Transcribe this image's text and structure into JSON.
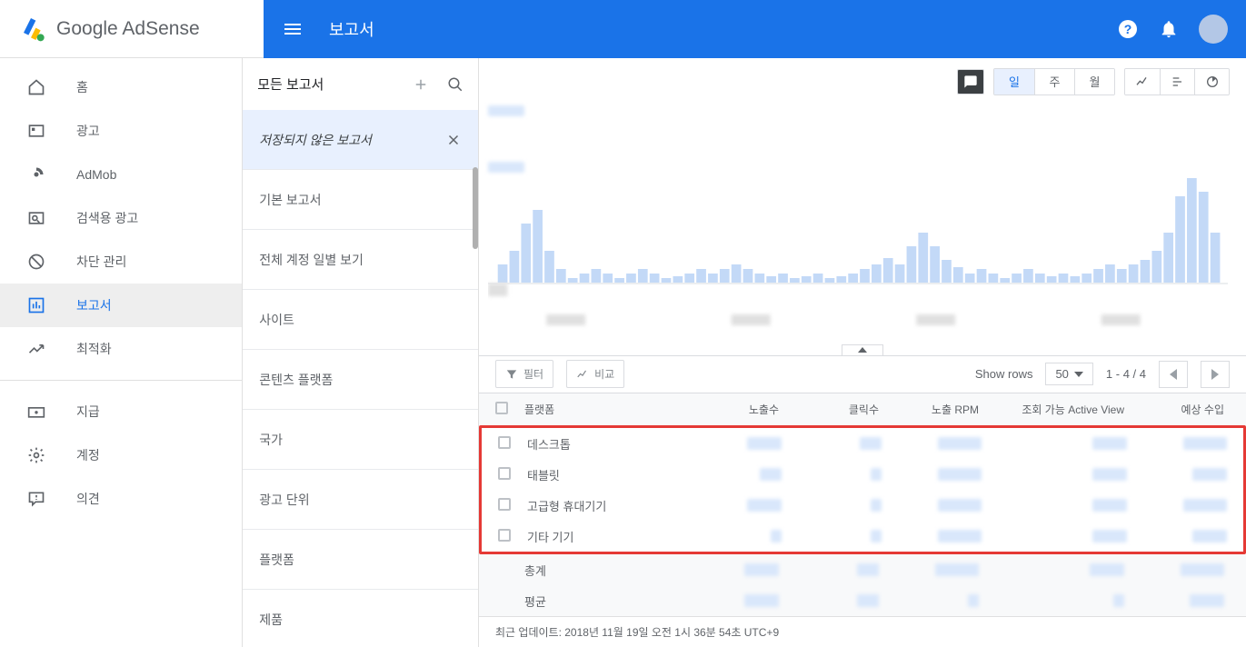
{
  "logo": {
    "text_left": "Google",
    "text_right": " AdSense"
  },
  "header": {
    "title": "보고서"
  },
  "nav": {
    "items": [
      {
        "label": "홈"
      },
      {
        "label": "광고"
      },
      {
        "label": "AdMob"
      },
      {
        "label": "검색용 광고"
      },
      {
        "label": "차단 관리"
      },
      {
        "label": "보고서"
      },
      {
        "label": "최적화"
      },
      {
        "label": "지급"
      },
      {
        "label": "계정"
      },
      {
        "label": "의견"
      }
    ]
  },
  "mid": {
    "title": "모든 보고서",
    "active": "저장되지 않은 보고서",
    "items": [
      "기본 보고서",
      "전체 계정 일별 보기",
      "사이트",
      "콘텐츠 플랫폼",
      "국가",
      "광고 단위",
      "플랫폼",
      "제품"
    ]
  },
  "timeframe": {
    "day": "일",
    "week": "주",
    "month": "월"
  },
  "tablebar": {
    "filter": "필터",
    "compare": "비교",
    "show_rows": "Show rows",
    "rows_count": "50",
    "page_info": "1 - 4 / 4"
  },
  "table": {
    "headers": {
      "platform": "플랫폼",
      "impressions": "노출수",
      "clicks": "클릭수",
      "rpm": "노출 RPM",
      "active_view": "조회 가능 Active View",
      "revenue": "예상 수입"
    },
    "rows": [
      {
        "platform": "데스크톱"
      },
      {
        "platform": "태블릿"
      },
      {
        "platform": "고급형 휴대기기"
      },
      {
        "platform": "기타 기기"
      }
    ],
    "summary": {
      "total": "총계",
      "average": "평균"
    }
  },
  "footer": {
    "updated": "최근 업데이트: 2018년 11월 19일 오전 1시 36분 54초 UTC+9"
  }
}
